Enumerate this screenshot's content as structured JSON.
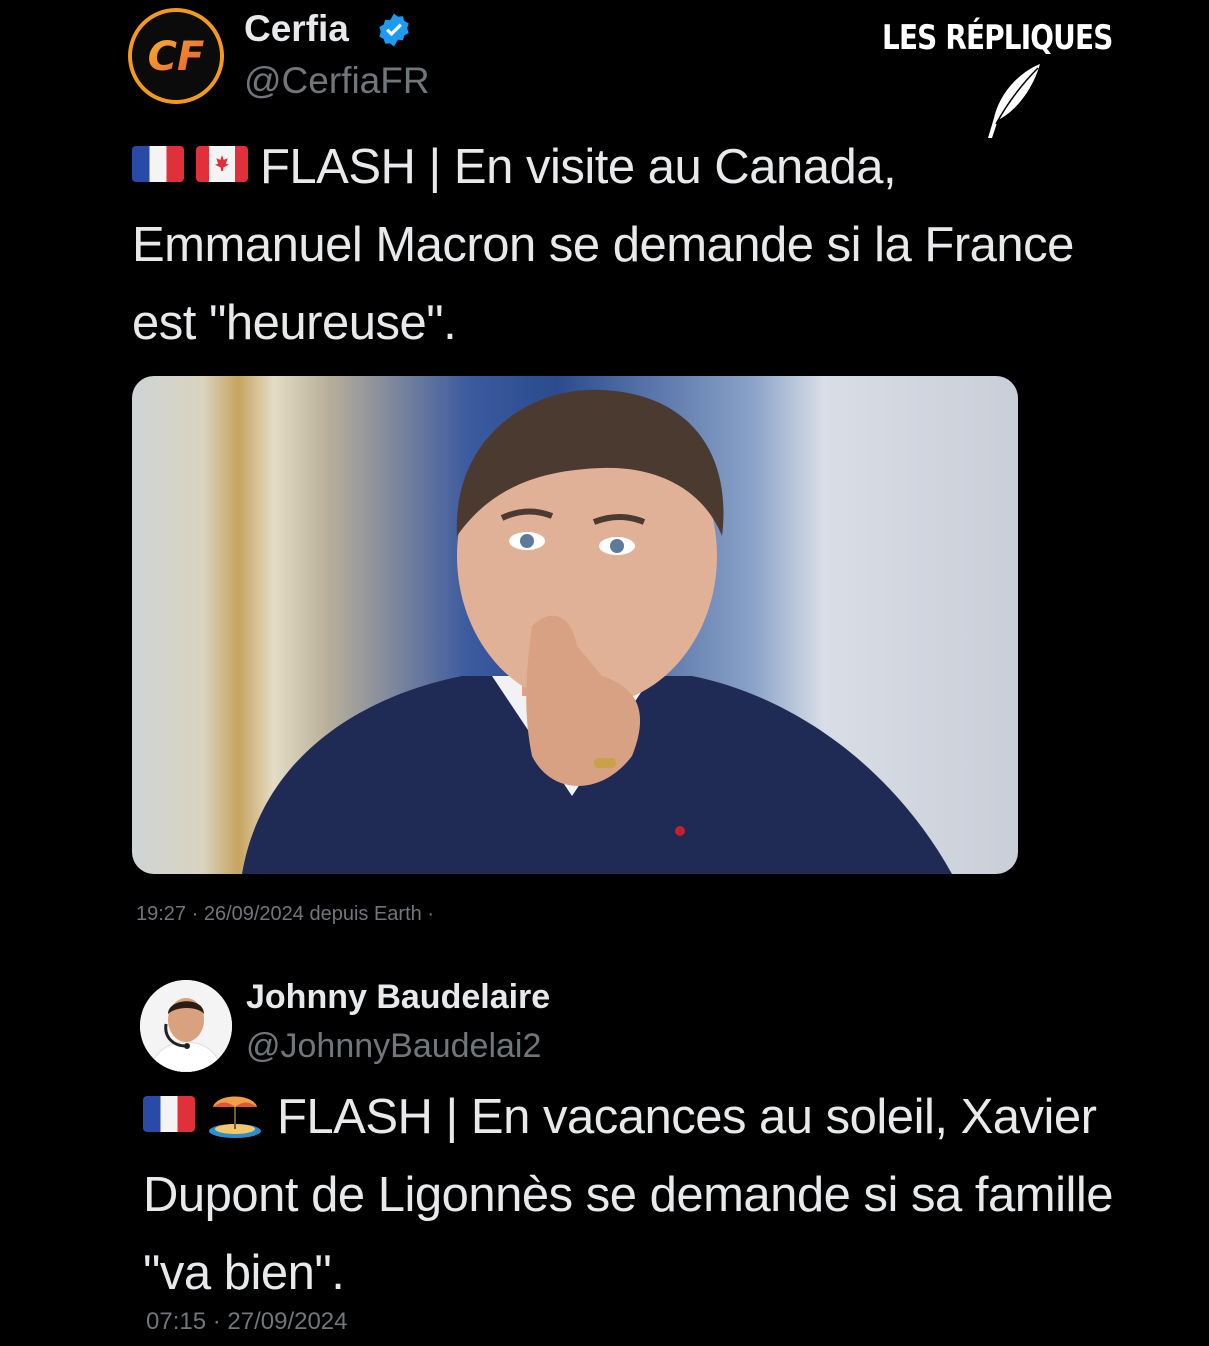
{
  "watermark": {
    "text": "LES RÉPLIQUES"
  },
  "tweet1": {
    "author_name": "Cerfia",
    "author_handle": "@CerfiaFR",
    "avatar_initials": "CF",
    "flags": [
      "flag-france",
      "flag-canada"
    ],
    "text": "FLASH | En visite au Canada, Emmanuel Macron se demande si la France est \"heureuse\".",
    "photo_icon": "photo-pensive-man-suit",
    "meta": "19:27 · 26/09/2024 depuis Earth ·"
  },
  "tweet2": {
    "author_name": "Johnny Baudelaire",
    "author_handle": "@JohnnyBaudelai2",
    "emojis": [
      "flag-france",
      "beach-umbrella-island"
    ],
    "text": "FLASH | En vacances au soleil, Xavier Dupont de Ligonnès se demande si sa famille \"va bien\".",
    "meta": "07:15 · 27/09/2024"
  },
  "colors": {
    "background": "#000000",
    "text_primary": "#e7e9ea",
    "text_secondary": "#71767b",
    "verified": "#1d9bf0",
    "cerfia_ring": "#f39a1d"
  }
}
